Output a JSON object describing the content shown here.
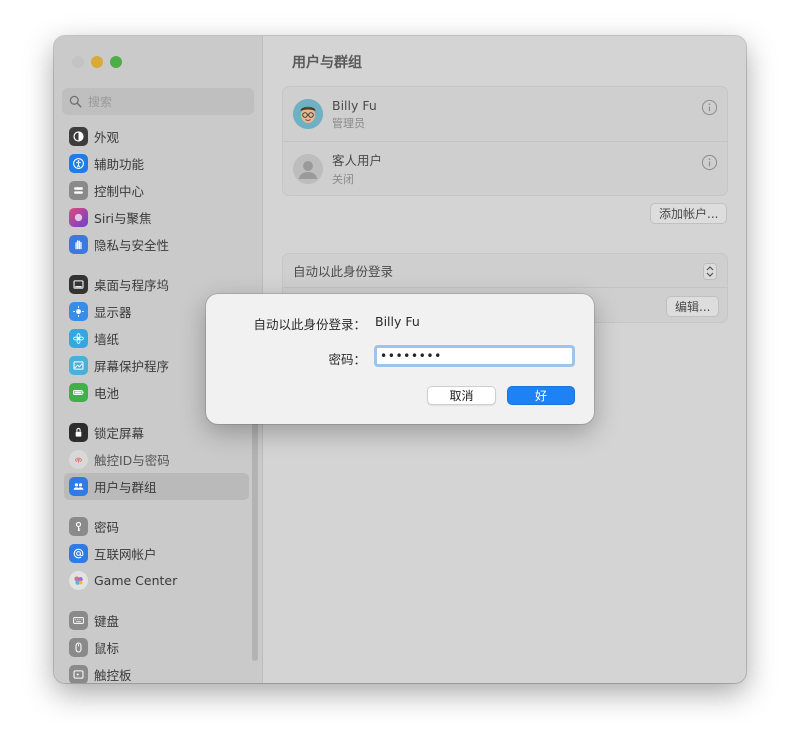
{
  "window": {
    "traffic_lights": [
      "close",
      "minimize",
      "maximize"
    ]
  },
  "sidebar": {
    "search": {
      "placeholder": "搜索",
      "value": ""
    },
    "items": [
      {
        "label": "外观",
        "icon": "appearance-icon",
        "color": "#3d3d3d"
      },
      {
        "label": "辅助功能",
        "icon": "accessibility-icon",
        "color": "#1f7ee6"
      },
      {
        "label": "控制中心",
        "icon": "control-center-icon",
        "color": "#8a8a8a"
      },
      {
        "label": "Siri与聚焦",
        "icon": "siri-icon",
        "color": "#c2369e"
      },
      {
        "label": "隐私与安全性",
        "icon": "privacy-hand-icon",
        "color": "#3a7ae0"
      },
      {
        "label": "桌面与程序坞",
        "icon": "desktop-dock-icon",
        "color": "#333333"
      },
      {
        "label": "显示器",
        "icon": "display-icon",
        "color": "#3a8ce9"
      },
      {
        "label": "墙纸",
        "icon": "wallpaper-icon",
        "color": "#35a7e0"
      },
      {
        "label": "屏幕保护程序",
        "icon": "screensaver-icon",
        "color": "#4bb0d8"
      },
      {
        "label": "电池",
        "icon": "battery-icon",
        "color": "#3fb04a"
      },
      {
        "label": "锁定屏幕",
        "icon": "lock-icon",
        "color": "#2d2d2d"
      },
      {
        "label": "触控ID与密码",
        "icon": "fingerprint-icon",
        "color": "#e06a6a"
      },
      {
        "label": "用户与群组",
        "icon": "users-icon",
        "color": "#2f7ae5"
      },
      {
        "label": "密码",
        "icon": "key-icon",
        "color": "#8a8a8a"
      },
      {
        "label": "互联网帐户",
        "icon": "at-icon",
        "color": "#2f7ae5"
      },
      {
        "label": "Game Center",
        "icon": "game-center-icon",
        "color": "#d05aa0"
      },
      {
        "label": "键盘",
        "icon": "keyboard-icon",
        "color": "#8a8a8a"
      },
      {
        "label": "鼠标",
        "icon": "mouse-icon",
        "color": "#8a8a8a"
      },
      {
        "label": "触控板",
        "icon": "trackpad-icon",
        "color": "#8a8a8a"
      }
    ],
    "selected": "用户与群组"
  },
  "content": {
    "title": "用户与群组",
    "users": [
      {
        "name": "Billy Fu",
        "role": "管理员",
        "avatar": "memoji-avatar"
      },
      {
        "name": "客人用户",
        "role": "关闭",
        "avatar": "guest-avatar"
      }
    ],
    "add_account_label": "添加帐户...",
    "autologin_label": "自动以此身份登录",
    "edit_label": "编辑...",
    "help_label": "?"
  },
  "dialog": {
    "autologin_label": "自动以此身份登录：",
    "autologin_user": "Billy Fu",
    "password_label": "密码：",
    "password_value": "••••••••",
    "cancel_label": "取消",
    "ok_label": "好",
    "accent_color": "#1e82f4"
  }
}
